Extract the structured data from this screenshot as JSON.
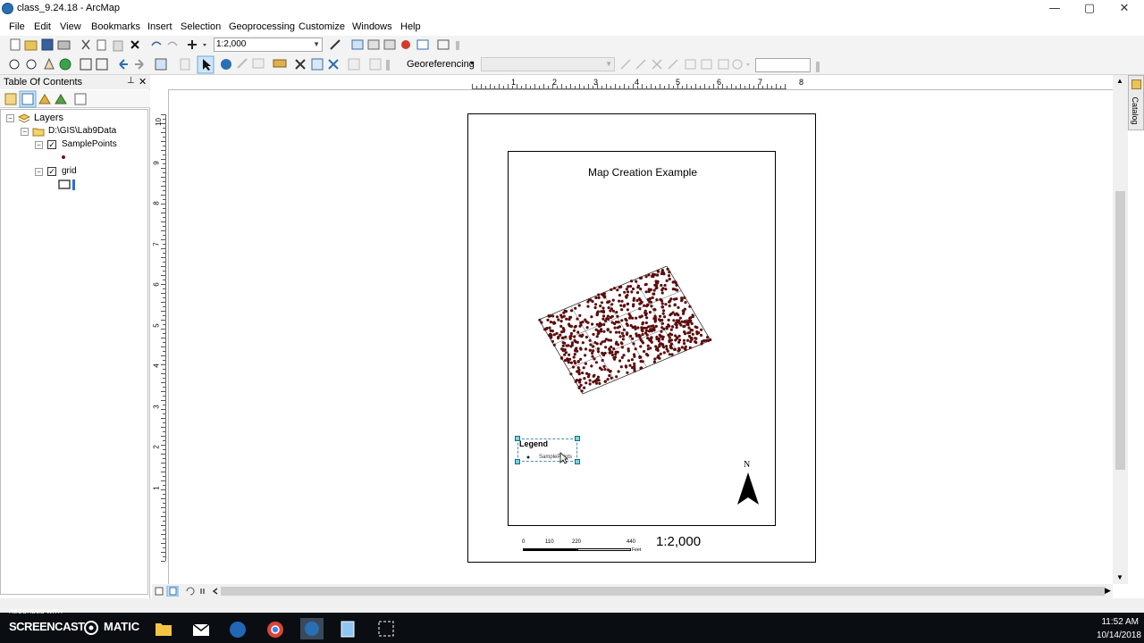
{
  "window": {
    "title": "class_9.24.18 - ArcMap",
    "controls": [
      "—",
      "▢",
      "✕"
    ]
  },
  "menubar": [
    "File",
    "Edit",
    "View",
    "Bookmarks",
    "Insert",
    "Selection",
    "Geoprocessing",
    "Customize",
    "Windows",
    "Help"
  ],
  "toolbar": {
    "scale_value": "1:2,000",
    "georeferencing_label": "Georeferencing"
  },
  "toc": {
    "title": "Table Of Contents",
    "pin": "⊥",
    "close": "✕",
    "tree": {
      "root": "Layers",
      "folder": "D:\\GIS\\Lab9Data",
      "layers": [
        {
          "name": "SamplePoints",
          "checked": true
        },
        {
          "name": "grid",
          "checked": true
        }
      ]
    }
  },
  "layout": {
    "map_title": "Map Creation Example",
    "legend_title": "Legend",
    "legend_item": "SamplePoints",
    "north_label": "N",
    "scale_ticks": [
      "0",
      "110",
      "220",
      "440"
    ],
    "scale_unit": "Feet",
    "scale_text": "1:2,000",
    "hruler_ticks": [
      "1",
      "2",
      "3",
      "4",
      "5",
      "6",
      "7",
      "8"
    ],
    "vruler_ticks": [
      "10",
      "9",
      "8",
      "7",
      "6",
      "5",
      "4",
      "3",
      "2",
      "1"
    ]
  },
  "catalog_tab": "Catalog",
  "taskbar": {
    "watermark_small": "RECORDED WITH",
    "watermark": "SCREENCAST",
    "watermark2": "MATIC",
    "time": "11:52 AM",
    "date": "10/14/2018"
  }
}
